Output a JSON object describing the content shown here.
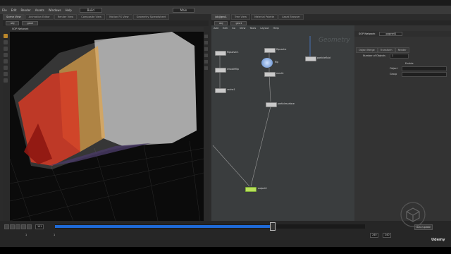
{
  "menubar": {
    "items": [
      "File",
      "Edit",
      "Render",
      "Assets",
      "Windows",
      "Help"
    ],
    "desktop": "Build",
    "main": "Main"
  },
  "left_tabs": [
    "Scene View",
    "Animation Editor",
    "Render View",
    "Composite View",
    "Motion FX View",
    "Geometry Spreadsheet"
  ],
  "right_tabs": [
    "/obj/geo1",
    "Tree View",
    "Material Palette",
    "Asset Browser"
  ],
  "left_path": {
    "net": "obj",
    "node": "geo1"
  },
  "right_path": {
    "net": "obj",
    "node": "geo1"
  },
  "viewport": {
    "title": "SOP Network",
    "persp": "Persp",
    "cam": "No cam"
  },
  "net_menu": [
    "Add",
    "Edit",
    "Go",
    "View",
    "Tools",
    "Layout",
    "Help"
  ],
  "net_watermark": "Geometry",
  "nodes": [
    {
      "name": "flipsolver1",
      "short": "file"
    },
    {
      "name": "smoothflip",
      "short": "smooth"
    },
    {
      "name": "cache1",
      "short": "file"
    },
    {
      "name": "flipcache",
      "short": "cache"
    },
    {
      "name": "flip",
      "short": "flip"
    },
    {
      "name": "mesh1",
      "short": "mesh"
    },
    {
      "name": "particlefluid",
      "short": ""
    },
    {
      "name": "particlesurface",
      "short": ""
    },
    {
      "name": "output0",
      "short": "out"
    }
  ],
  "params": {
    "title": "SOP Network",
    "node": "popnet1",
    "tabs": [
      "Object Merge",
      "Transform",
      "Render"
    ],
    "num_objects": "Number of Objects",
    "num_value": "1",
    "enable_label": "Enable",
    "object_label": "Object",
    "group_label": "Group"
  },
  "timeline": {
    "frame": "101",
    "start": "1",
    "end": "240",
    "end2": "240",
    "fps_label": "Auto Update",
    "progress": 0.7
  },
  "branding": {
    "udemy": "Udemy"
  }
}
